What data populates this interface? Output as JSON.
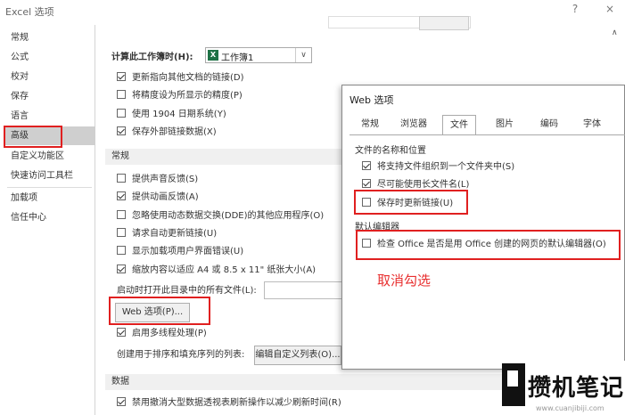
{
  "window": {
    "title": "Excel 选项",
    "help": "?",
    "close": "×"
  },
  "sidebar": {
    "items": [
      "常规",
      "公式",
      "校对",
      "保存",
      "语言",
      "高级",
      "自定义功能区",
      "快速访问工具栏",
      "加载项",
      "信任中心"
    ],
    "active": "高级"
  },
  "main": {
    "workbook_label": "计算此工作簿时(H):",
    "workbook_select": "工作簿1",
    "workbook_options": [
      {
        "label": "更新指向其他文档的链接(D)",
        "checked": true
      },
      {
        "label": "将精度设为所显示的精度(P)",
        "checked": false
      },
      {
        "label": "使用 1904 日期系统(Y)",
        "checked": false
      },
      {
        "label": "保存外部链接数据(X)",
        "checked": true
      }
    ],
    "general_heading": "常规",
    "general_options": [
      {
        "label": "提供声音反馈(S)",
        "checked": false
      },
      {
        "label": "提供动画反馈(A)",
        "checked": true
      },
      {
        "label": "忽略使用动态数据交换(DDE)的其他应用程序(O)",
        "checked": false
      },
      {
        "label": "请求自动更新链接(U)",
        "checked": false
      },
      {
        "label": "显示加载项用户界面错误(U)",
        "checked": false
      },
      {
        "label": "缩放内容以适应 A4 或 8.5 x 11\" 纸张大小(A)",
        "checked": true
      }
    ],
    "startup_label": "启动时打开此目录中的所有文件(L):",
    "web_options_button": "Web 选项(P)...",
    "multithread_label": "启用多线程处理(P)",
    "sort_list_label": "创建用于排序和填充序列的列表:",
    "edit_list_button": "编辑自定义列表(O)...",
    "data_heading": "数据",
    "data_option": "禁用撤消大型数据透视表刷新操作以减少刷新时间(R)"
  },
  "dialog": {
    "title": "Web 选项",
    "tabs": [
      "常规",
      "浏览器",
      "文件",
      "图片",
      "编码",
      "字体"
    ],
    "active_tab": "文件",
    "names_section": "文件的名称和位置",
    "names_options": [
      {
        "label": "将支持文件组织到一个文件夹中(S)",
        "checked": true
      },
      {
        "label": "尽可能使用长文件名(L)",
        "checked": true
      },
      {
        "label": "保存时更新链接(U)",
        "checked": false
      }
    ],
    "editor_section": "默认编辑器",
    "editor_option": "检查 Office 是否是用 Office 创建的网页的默认编辑器(O)"
  },
  "annotation": "取消勾选",
  "watermark": {
    "text": "攒机笔记",
    "url": "www.cuanjibiji.com"
  },
  "colors": {
    "highlight_red": "#e02020",
    "sidebar_active": "#cfcfcf",
    "excel_green": "#1e7145"
  }
}
